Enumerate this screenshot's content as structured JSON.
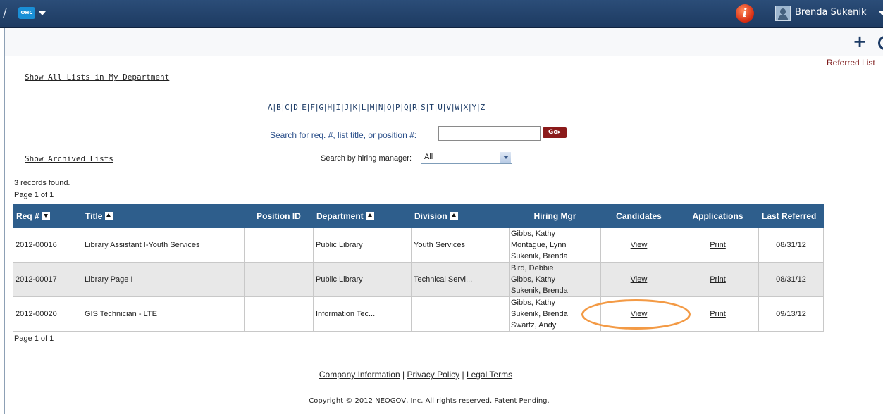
{
  "topbar": {
    "app_badge": "OHC",
    "user_name": "Brenda Sukenik",
    "info_icon": "i"
  },
  "toolbar": {
    "add_icon": "+",
    "referred_label": "Referred List"
  },
  "links": {
    "show_all": "Show All Lists in My Department",
    "show_archived": "Show Archived Lists"
  },
  "alphabet": [
    "A",
    "B",
    "C",
    "D",
    "E",
    "F",
    "G",
    "H",
    "I",
    "J",
    "K",
    "L",
    "M",
    "N",
    "O",
    "P",
    "Q",
    "R",
    "S",
    "T",
    "U",
    "V",
    "W",
    "X",
    "Y",
    "Z"
  ],
  "search": {
    "label": "Search for req. #, list title, or position #:",
    "value": "",
    "go_label": "Go▸"
  },
  "manager_filter": {
    "label": "Search by hiring manager:",
    "selected": "All"
  },
  "summary": {
    "records": "3 records found.",
    "page_top": "Page 1 of 1",
    "page_bottom": "Page 1 of 1"
  },
  "table": {
    "headers": [
      "Req #",
      "Title",
      "Position ID",
      "Department",
      "Division",
      "Hiring Mgr",
      "Candidates",
      "Applications",
      "Last Referred"
    ],
    "rows": [
      {
        "req": "2012-00016",
        "title": "Library Assistant I-Youth Services",
        "position_id": "",
        "department": "Public Library",
        "division": "Youth Services",
        "managers": [
          "Gibbs, Kathy",
          "Montague, Lynn",
          "Sukenik, Brenda"
        ],
        "candidates": "View",
        "applications": "Print",
        "last_referred": "08/31/12"
      },
      {
        "req": "2012-00017",
        "title": "Library Page I",
        "position_id": "",
        "department": "Public Library",
        "division": "Technical Servi...",
        "managers": [
          "Bird, Debbie",
          "Gibbs, Kathy",
          "Sukenik, Brenda"
        ],
        "candidates": "View",
        "applications": "Print",
        "last_referred": "08/31/12"
      },
      {
        "req": "2012-00020",
        "title": "GIS Technician - LTE",
        "position_id": "",
        "department": "Information Tec...",
        "division": "",
        "managers": [
          "Gibbs, Kathy",
          "Sukenik, Brenda",
          "Swartz, Andy"
        ],
        "candidates": "View",
        "applications": "Print",
        "last_referred": "09/13/12"
      }
    ]
  },
  "footer": {
    "company_info": "Company Information",
    "privacy": "Privacy Policy",
    "legal": "Legal Terms",
    "separator": "|",
    "copyright": "Copyright © 2012 NEOGOV, Inc. All rights reserved. Patent Pending."
  },
  "colors": {
    "header_bg": "#2e5e8c",
    "topbar_bg": "#1d3a61",
    "highlight": "#f39a45",
    "go_button": "#8b1a1a"
  }
}
